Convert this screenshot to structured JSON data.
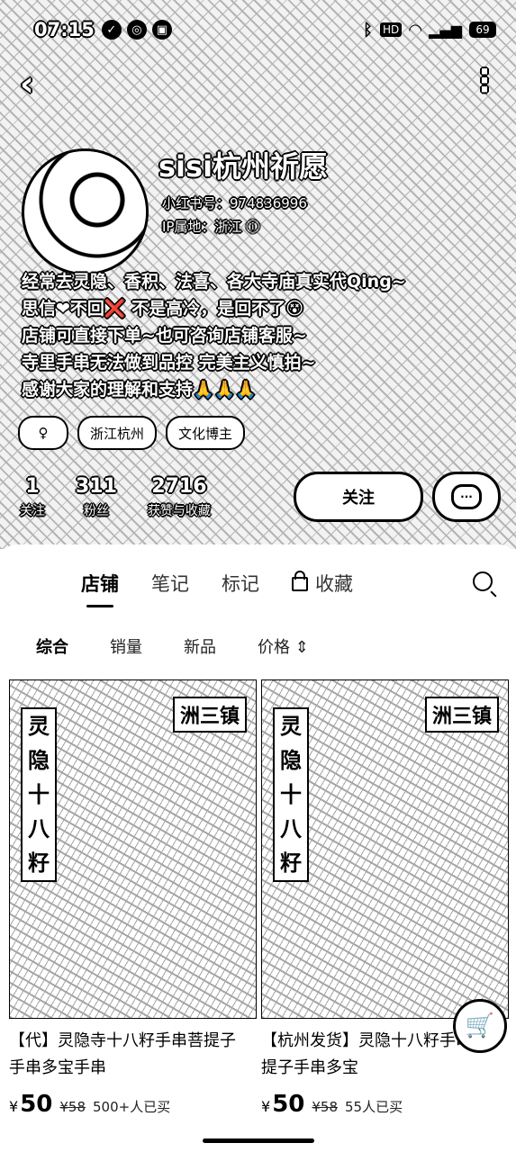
{
  "status_bar": {
    "time": "07:15",
    "icons": [
      "check-circle-icon",
      "app-icon",
      "photo-icon"
    ],
    "hd": "HD",
    "battery": "69"
  },
  "profile": {
    "nickname": "sisi杭州祈愿",
    "red_id": "小红书号：974836996",
    "ip": "IP属地：浙江 ⓘ",
    "bio": [
      "经常去灵隐、香积、法喜、各大寺庙真实代Qing~",
      "思信❤不回❌ 不是高冷，是回不了😵",
      "店铺可直接下单~也可咨询店铺客服~",
      "寺里手串无法做到品控 完美主义慎拍~",
      "感谢大家的理解和支持🙏🙏🙏"
    ],
    "tags": [
      "♀",
      "浙江杭州",
      "文化博主"
    ],
    "stats": [
      {
        "num": "1",
        "label": "关注"
      },
      {
        "num": "311",
        "label": "粉丝"
      },
      {
        "num": "2716",
        "label": "获赞与收藏"
      }
    ],
    "follow_label": "关注",
    "message_icon": "···"
  },
  "tabs": [
    "店铺",
    "笔记",
    "标记",
    "收藏"
  ],
  "sorts": [
    "综合",
    "销量",
    "新品",
    "价格 ⇕"
  ],
  "products": [
    {
      "title": "【代】灵隐寺十八籽手串菩提子手串多宝手串",
      "yen": "¥",
      "price": "50",
      "old_price": "¥58",
      "sold": "500+人已买",
      "vertical_label": [
        "灵",
        "隐",
        "十",
        "八",
        "籽"
      ],
      "sign": "洲三镇"
    },
    {
      "title": "【杭州发货】灵隐十八籽手串菩提子手串多宝",
      "yen": "¥",
      "price": "50",
      "old_price": "¥58",
      "sold": "55人已买",
      "vertical_label": [
        "灵",
        "隐",
        "十",
        "八",
        "籽"
      ],
      "sign": "洲三镇"
    }
  ]
}
